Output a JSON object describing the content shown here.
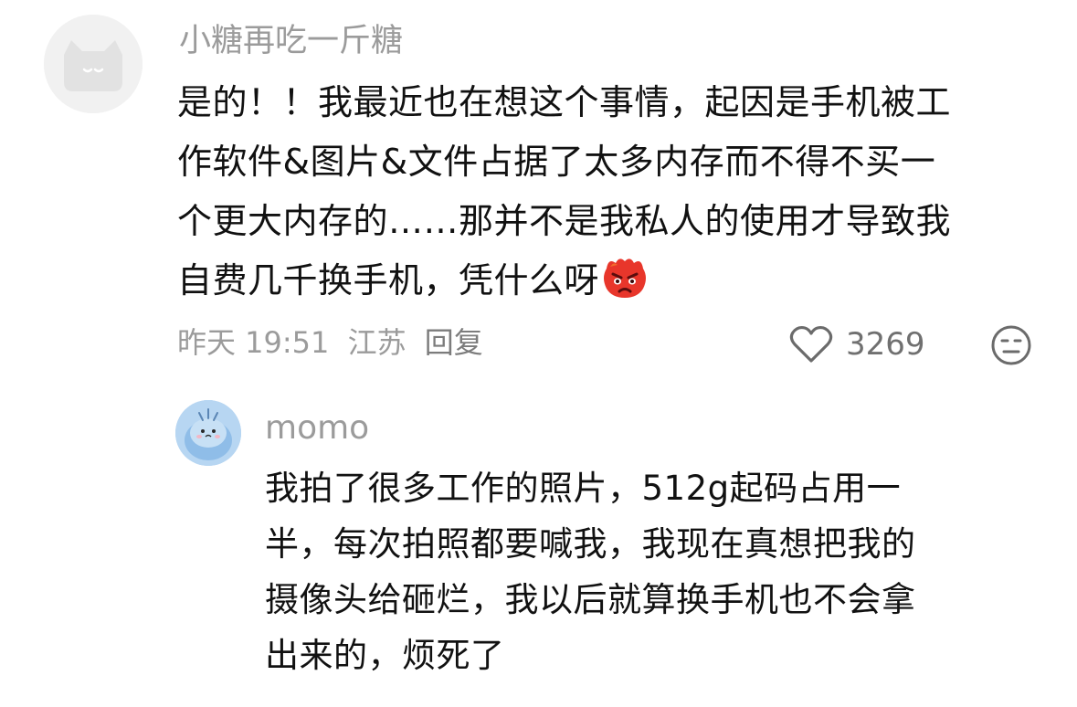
{
  "comment": {
    "username": "小糖再吃一斤糖",
    "text_lines": [
      "是的！！我最近也在想这个事情，起因是手机被工",
      "作软件&图片&文件占据了太多内存而不得不买一",
      "个更大内存的……那并不是我私人的使用才导致我",
      "自费几千换手机，凭什么呀"
    ],
    "emoji": "angry-face-emoji",
    "time": "昨天 19:51",
    "location": "江苏",
    "reply_label": "回复",
    "like_count": "3269",
    "colors": {
      "meta_text": "#9b9b9b",
      "body_text": "#111111",
      "emoji_red": "#e8362b"
    }
  },
  "reply": {
    "username": "momo",
    "text_lines": [
      "我拍了很多工作的照片，512g起码占用一",
      "半，每次拍照都要喊我，我现在真想把我的",
      "摄像头给砸烂，我以后就算换手机也不会拿",
      "出来的，烦死了"
    ]
  }
}
